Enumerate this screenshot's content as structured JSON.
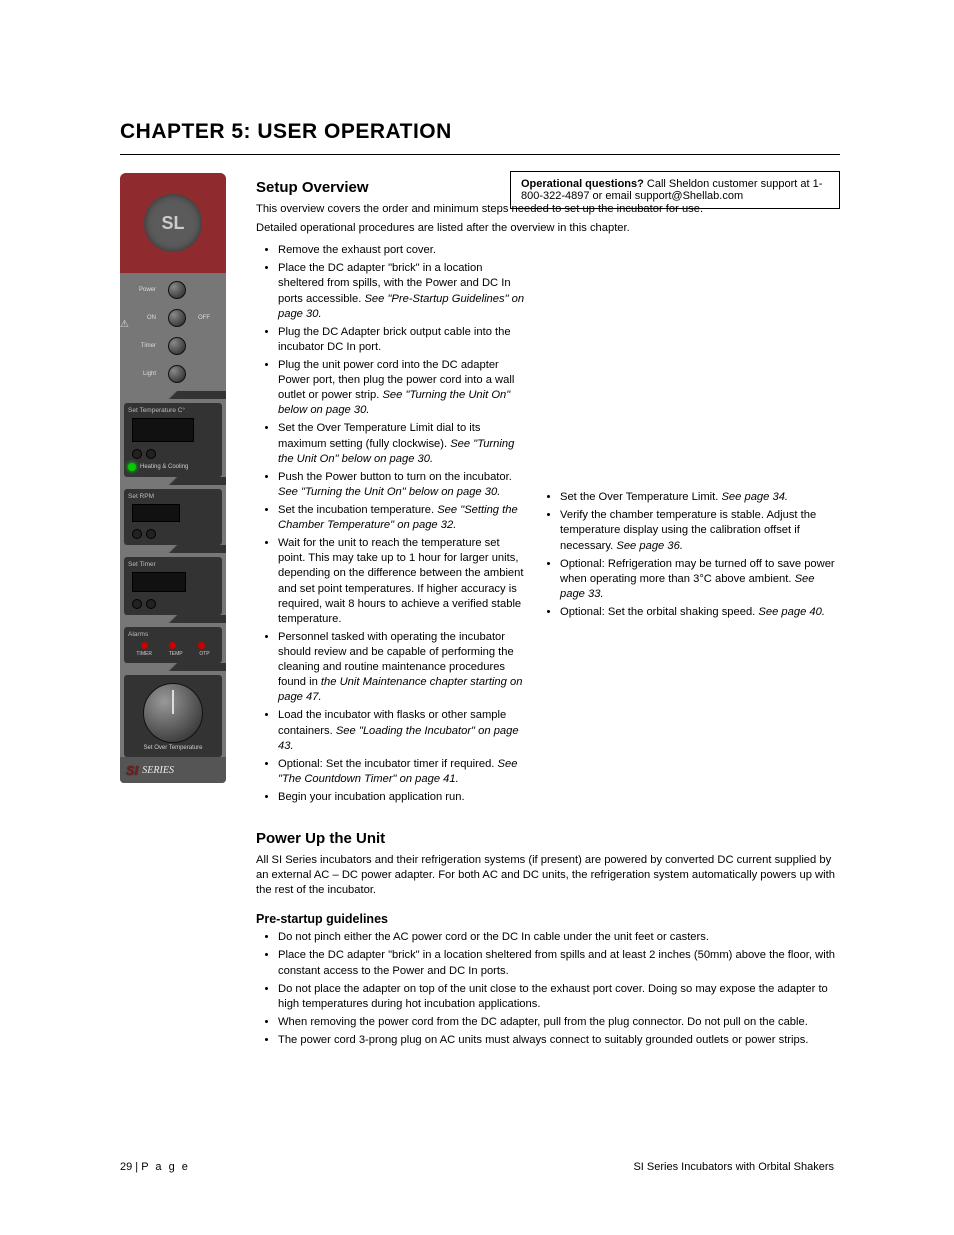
{
  "chapter_title": "CHAPTER 5: USER OPERATION",
  "help_box": {
    "lead": "Operational questions?",
    "rest": " Call Sheldon customer support at 1-800-322-4897 or email support@Shellab.com"
  },
  "panel": {
    "logo_text": "SL",
    "switches": [
      {
        "left": "Power",
        "right": ""
      },
      {
        "left": "ON",
        "right": "OFF"
      },
      {
        "left": "Timer",
        "right": ""
      },
      {
        "left": "Light",
        "right": ""
      }
    ],
    "section_set_temp": {
      "header": "Set Temperature C°",
      "footer": "Heating & Cooling"
    },
    "section_set_rpm": {
      "header": "Set RPM"
    },
    "section_set_timer": {
      "header": "Set Timer"
    },
    "section_alarms": {
      "header": "Alarms",
      "labels": [
        "TIMER",
        "TEMP",
        "OTP"
      ]
    },
    "section_ot": {
      "footer": "Set Over Temperature"
    },
    "series": {
      "si": "SI",
      "series_word": "SERIES"
    }
  },
  "overview": {
    "heading": "Setup Overview",
    "intro_1": "This overview covers the order and minimum steps needed to set up the incubator for use.",
    "intro_2": "Detailed operational procedures are listed after the overview in this chapter.",
    "steps": [
      "Remove the exhaust port cover.",
      {
        "text": "Place the DC adapter \"brick\" in a location sheltered from spills, with the Power and DC In ports accessible. ",
        "note": "See \"Pre-Startup Guidelines\" on page 30."
      },
      "Plug the DC Adapter brick output cable into the incubator DC In port.",
      {
        "text": "Plug the unit power cord into the DC adapter Power port, then plug the power cord into a wall outlet or power strip. ",
        "note": "See \"Turning the Unit On\" below on page 30."
      },
      {
        "text": "Set the Over Temperature Limit dial to its maximum setting (fully clockwise). ",
        "note": "See \"Turning the Unit On\" below on page 30."
      },
      {
        "text": "Push the Power button to turn on the incubator. ",
        "note": "See \"Turning the Unit On\" below on page 30."
      },
      {
        "text": "Set the incubation temperature. ",
        "note": "See \"Setting the Chamber Temperature\" on page 32."
      },
      {
        "text": "Wait for the unit to reach the temperature set point. This may take up to 1 hour for larger units, depending on the difference between the ambient and set point temperatures. If higher accuracy is required, wait 8 hours to achieve a verified stable temperature.",
        "sublist": [
          {
            "text": "Set the Over Temperature Limit. ",
            "note": "See page 34."
          },
          {
            "text": "Verify the chamber temperature is stable. Adjust the temperature display using the calibration offset if necessary. ",
            "note": "See page 36."
          },
          {
            "text": "Optional: Refrigeration may be turned off to save power when operating more than 3°C above ambient. ",
            "note": "See page 33."
          },
          {
            "text": "Optional: Set the orbital shaking speed. ",
            "note": "See page 40."
          }
        ]
      },
      {
        "text": "Personnel tasked with operating the incubator should review and be capable of performing the cleaning and routine maintenance procedures found in ",
        "note": "the Unit Maintenance chapter starting on page 47."
      },
      {
        "text": "Load the incubator with flasks or other sample containers. ",
        "note": "See \"Loading the Incubator\" on page 43."
      },
      {
        "text": "Optional: Set the incubator timer if required. ",
        "note": "See \"The Countdown Timer\" on page 41."
      },
      "Begin your incubation application run."
    ]
  },
  "power_up": {
    "heading": "Power Up the Unit",
    "p1": "All SI Series incubators and their refrigeration systems (if present) are powered by converted DC current supplied by an external AC – DC power adapter. For both AC and DC units, the refrigeration system automatically powers up with the rest of the incubator.",
    "pre_heading": "Pre-startup guidelines",
    "pre_list": [
      "Do not pinch either the AC power cord or the DC In cable under the unit feet or casters.",
      "Place the DC adapter \"brick\" in a location sheltered from spills and at least 2 inches (50mm) above the floor, with constant access to the Power and DC In ports.",
      "Do not place the adapter on top of the unit close to the exhaust port cover. Doing so may expose the adapter to high temperatures during hot incubation applications.",
      "When removing the power cord from the DC adapter, pull from the plug connector. Do not pull on the cable.",
      "The power cord 3-prong plug on AC units must always connect to suitably grounded outlets or power strips."
    ]
  },
  "footer": {
    "page": "29",
    "divider": " | ",
    "page_label": "P a g e",
    "doc": "SI Series Incubators with Orbital Shakers"
  }
}
